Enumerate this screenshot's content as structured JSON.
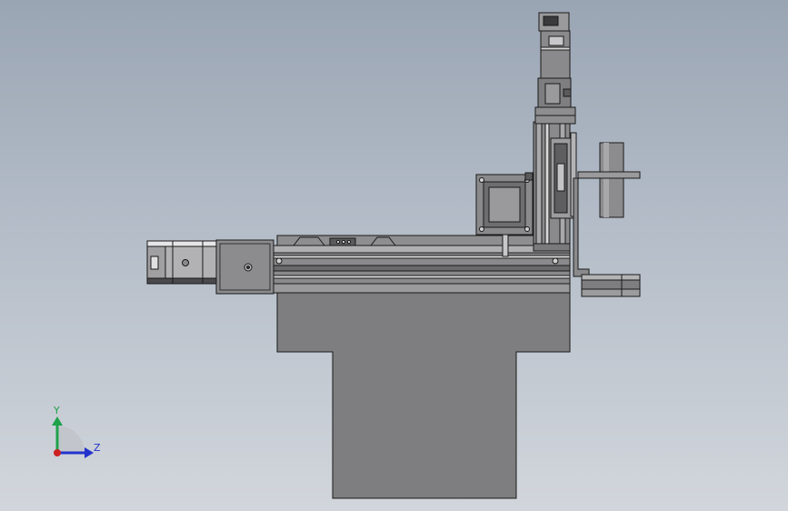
{
  "viewport": {
    "background_top": "#9aa5b4",
    "background_bottom": "#d2d6dc"
  },
  "colors": {
    "part_fill": "#7e7e80",
    "part_dark": "#5a5a5c",
    "part_light": "#a6a6a8",
    "edge": "#1a1a1a",
    "rail_light": "#d8d8d8"
  },
  "triad": {
    "y_label": "Y",
    "z_label": "Z",
    "y_color": "#1fa24a",
    "z_color": "#2233cc",
    "x_color": "#cc2222"
  }
}
